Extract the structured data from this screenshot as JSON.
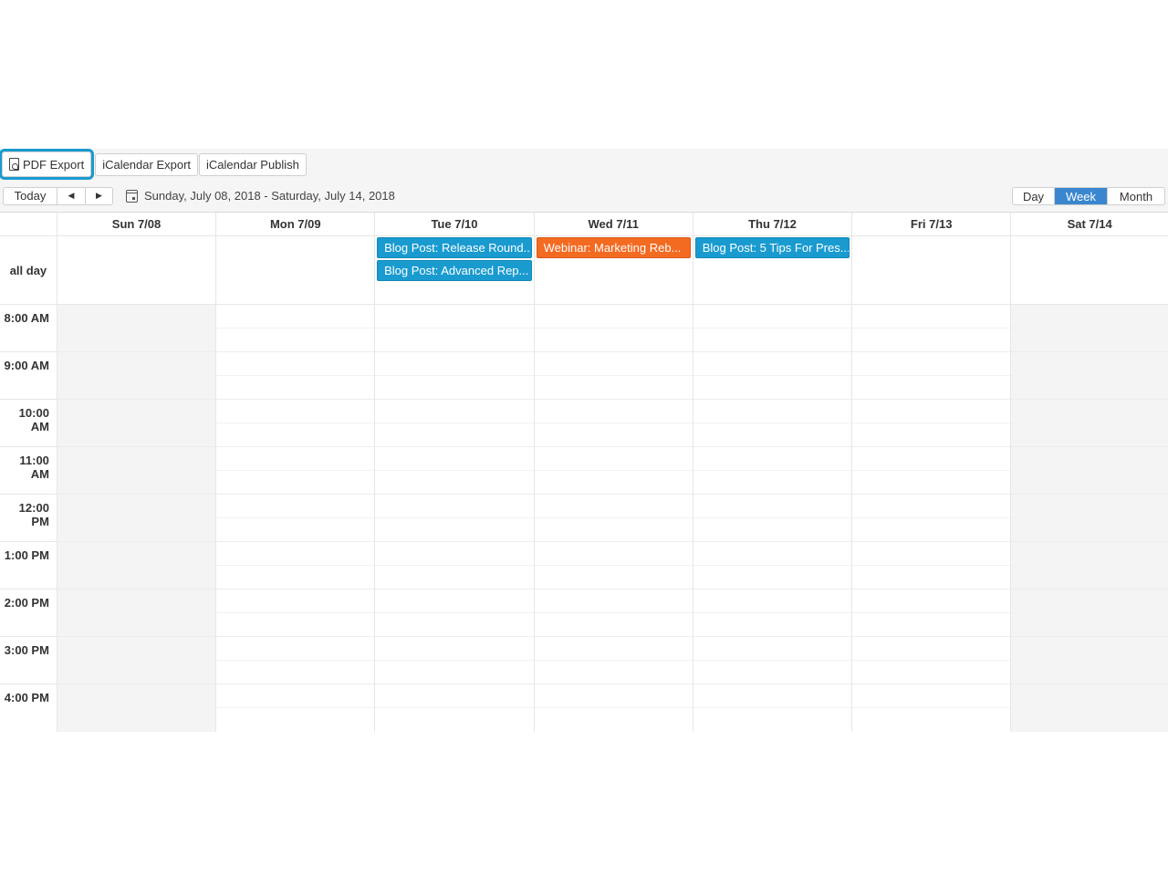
{
  "toolbar": {
    "pdf_export": "PDF Export",
    "icalendar_export": "iCalendar Export",
    "icalendar_publish": "iCalendar Publish"
  },
  "navigation": {
    "today": "Today",
    "prev": "◀",
    "next": "▶",
    "date_range": "Sunday, July 08, 2018 - Saturday, July 14, 2018"
  },
  "views": {
    "day": "Day",
    "week": "Week",
    "month": "Month",
    "selected": "Week"
  },
  "days": [
    "Sun 7/08",
    "Mon 7/09",
    "Tue 7/10",
    "Wed 7/11",
    "Thu 7/12",
    "Fri 7/13",
    "Sat 7/14"
  ],
  "allday_label": "all day",
  "events": {
    "tue_1": "Blog Post: Release Round...",
    "tue_2": "Blog Post: Advanced Rep...",
    "wed_1": "Webinar: Marketing Reb...",
    "thu_1": "Blog Post: 5 Tips For Pres..."
  },
  "hours": [
    "8:00 AM",
    "9:00 AM",
    "10:00 AM",
    "11:00 AM",
    "12:00 PM",
    "1:00 PM",
    "2:00 PM",
    "3:00 PM",
    "4:00 PM"
  ],
  "colors": {
    "event_blue": "#1a9bd0",
    "event_orange": "#f36a21",
    "selected_view": "#3a87cf",
    "focus_outline": "#1a9bd0"
  }
}
